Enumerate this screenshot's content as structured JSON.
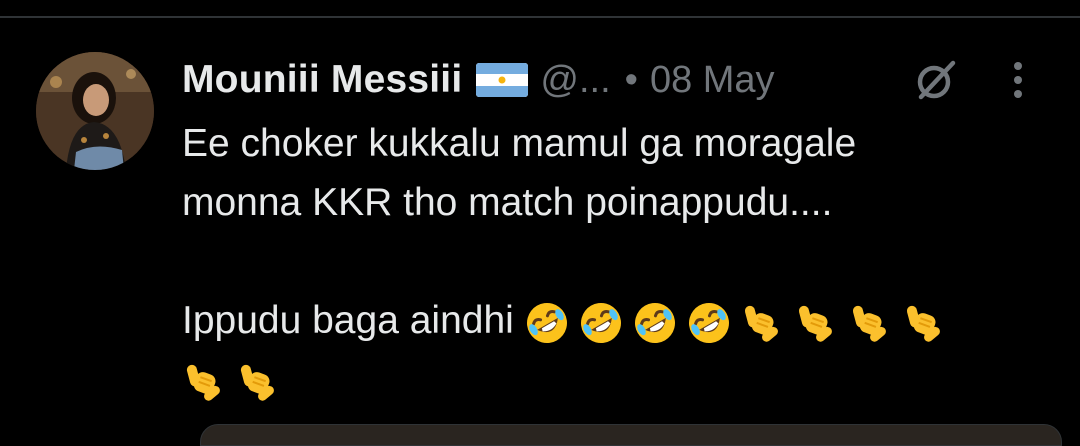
{
  "tweet": {
    "author": {
      "display_name": "Mouniii Messiii",
      "flag_icon": "argentina-flag-icon",
      "handle": "@...",
      "avatar_icon": "profile-avatar"
    },
    "separator": "•",
    "timestamp": "08 May",
    "actions": {
      "grok_icon": "grok-icon",
      "more_icon": "more-vertical-icon"
    },
    "text_lines": [
      "Ee choker kukkalu mamul ga moragale",
      "monna KKR tho match poinappudu....",
      "",
      "Ippudu baga aindhi"
    ],
    "emojis_line1": [
      "rolling-on-floor-laughing",
      "rolling-on-floor-laughing",
      "rolling-on-floor-laughing",
      "rolling-on-floor-laughing",
      "call-me-hand",
      "call-me-hand",
      "call-me-hand",
      "call-me-hand"
    ],
    "emojis_line2": [
      "call-me-hand",
      "call-me-hand"
    ]
  },
  "colors": {
    "background": "#000000",
    "primary_text": "#e7e9ea",
    "secondary_text": "#71767b",
    "divider": "#2f3336"
  }
}
